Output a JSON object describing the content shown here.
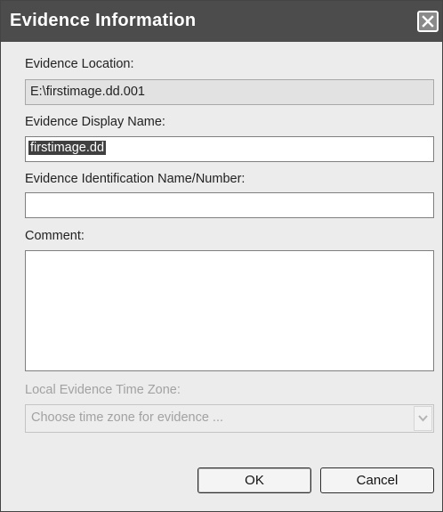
{
  "window": {
    "title": "Evidence Information"
  },
  "evidence_location": {
    "label": "Evidence Location:",
    "value": "E:\\firstimage.dd.001"
  },
  "display_name": {
    "label": "Evidence Display Name:",
    "value": "firstimage.dd"
  },
  "identification": {
    "label": "Evidence Identification Name/Number:",
    "value": ""
  },
  "comment": {
    "label": "Comment:",
    "value": ""
  },
  "time_zone": {
    "label": "Local Evidence Time Zone:",
    "placeholder": "Choose time zone for evidence ..."
  },
  "buttons": {
    "ok": "OK",
    "cancel": "Cancel"
  },
  "icons": {
    "close": "close-icon",
    "dropdown": "chevron-down-icon"
  },
  "colors": {
    "titlebar": "#4c4c4c",
    "dialog_bg": "#ececec",
    "selection": "#404040"
  }
}
